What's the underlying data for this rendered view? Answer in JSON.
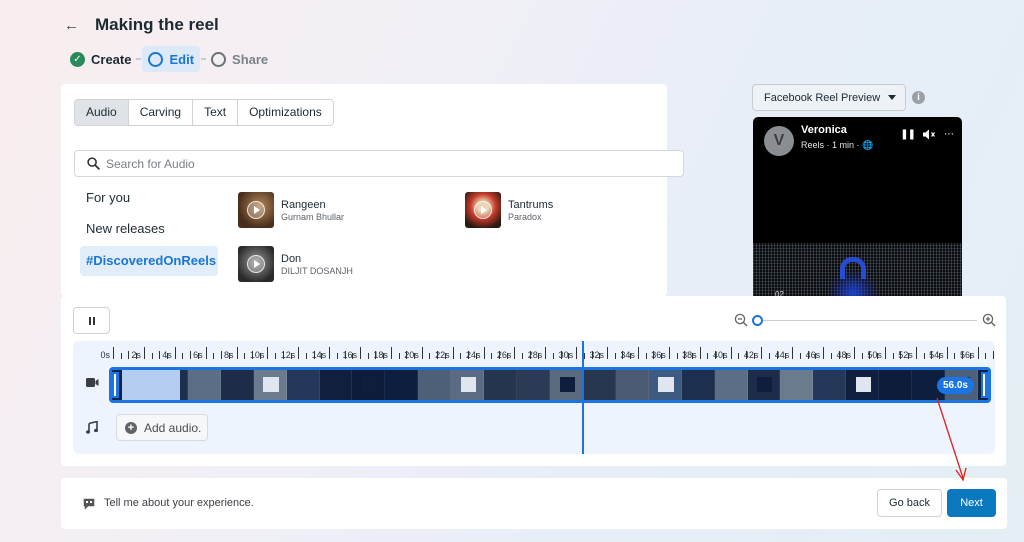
{
  "header": {
    "title": "Making the reel",
    "back_icon": "arrow-left-icon",
    "steps": [
      {
        "label": "Create",
        "state": "done",
        "icon": "check-circle-icon"
      },
      {
        "label": "Edit",
        "state": "active",
        "icon": "circle-icon"
      },
      {
        "label": "Share",
        "state": "todo",
        "icon": "circle-icon"
      }
    ]
  },
  "audio_panel": {
    "tabs": [
      {
        "label": "Audio",
        "active": true
      },
      {
        "label": "Carving",
        "active": false
      },
      {
        "label": "Text",
        "active": false
      },
      {
        "label": "Optimizations",
        "active": false
      }
    ],
    "search": {
      "placeholder": "Search for Audio",
      "value": ""
    },
    "categories": [
      {
        "label": "For you",
        "active": false
      },
      {
        "label": "New releases",
        "active": false
      },
      {
        "label": "#DiscoveredOnReels",
        "active": true
      }
    ],
    "tracks": [
      {
        "title": "Rangeen",
        "artist": "Gurnam Bhullar"
      },
      {
        "title": "Tantrums",
        "artist": "Paradox"
      },
      {
        "title": "Don",
        "artist": "DILJIT DOSANJH"
      }
    ]
  },
  "preview": {
    "selector_label": "Facebook Reel Preview",
    "account_initial": "V",
    "account_name": "Veronica",
    "meta": "Reels · 1 min · 🌐",
    "overlay_number": "02"
  },
  "timeline": {
    "zoom_level": 0,
    "ruler_labels": [
      "0s",
      "2s",
      "4s",
      "6s",
      "8s",
      "10s",
      "12s",
      "14s",
      "16s",
      "18s",
      "20s",
      "22s",
      "24s",
      "26s",
      "28s",
      "30s",
      "32s",
      "34s",
      "36s",
      "38s",
      "40s",
      "42s",
      "44s",
      "46s",
      "48s",
      "50s",
      "52s",
      "54s",
      "56s"
    ],
    "max_seconds": 57,
    "playhead_seconds": 30.4,
    "clip_duration": "56.0s",
    "add_audio_label": "Add audio."
  },
  "footer": {
    "feedback_text": "Tell me about your experience.",
    "go_back_label": "Go back",
    "next_label": "Next"
  },
  "colors": {
    "accent": "#1b74e4",
    "primary_button": "#0a78be",
    "success": "#2a8a5b",
    "annotation_arrow": "#e02020"
  }
}
